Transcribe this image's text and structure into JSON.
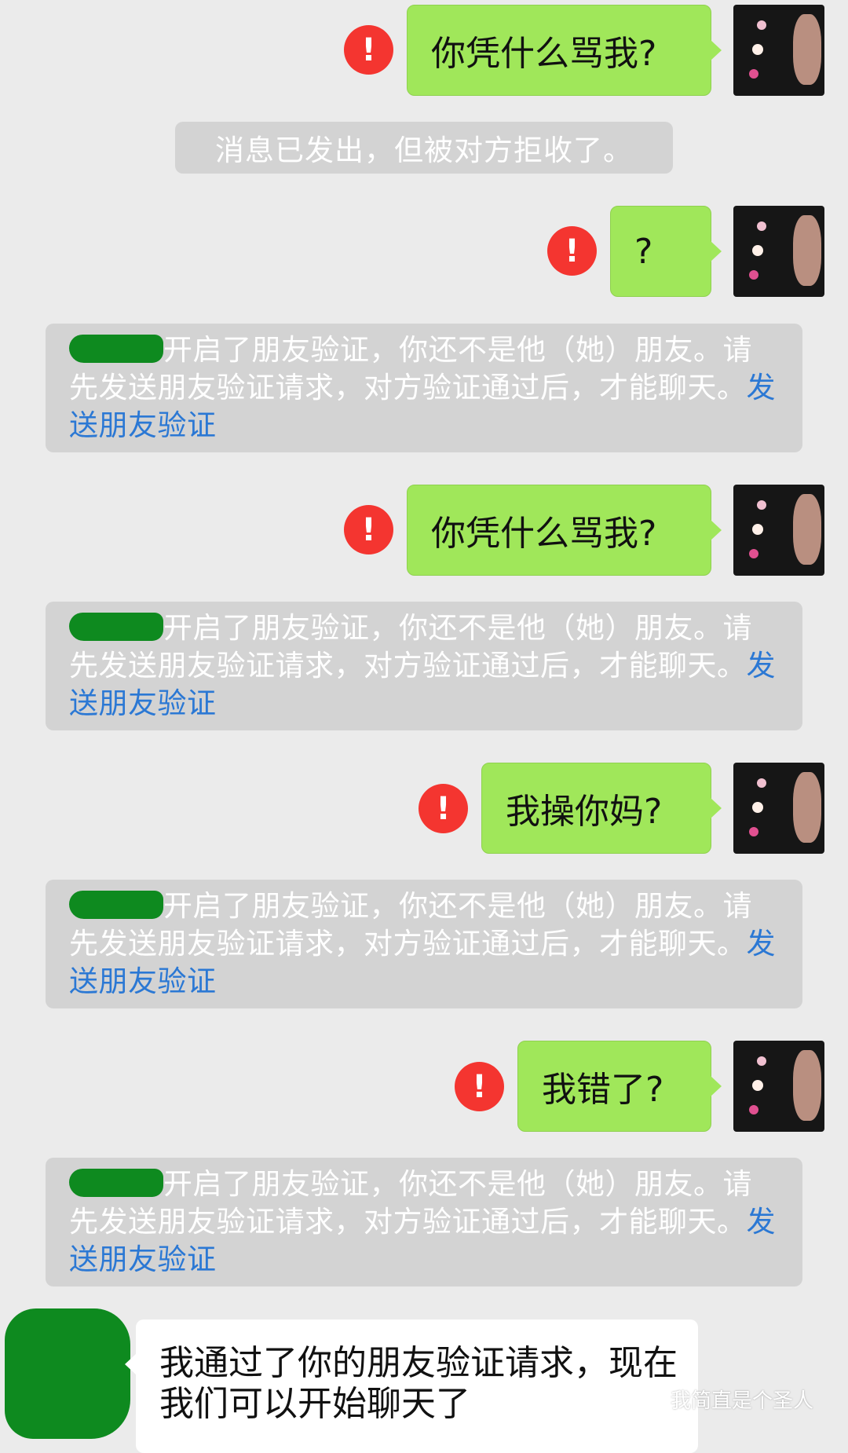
{
  "messages": [
    {
      "type": "out",
      "text": "你凭什么骂我?",
      "status": "failed"
    },
    {
      "type": "notice",
      "text": "消息已发出，但被对方拒收了。"
    },
    {
      "type": "out",
      "text": "?",
      "status": "failed"
    },
    {
      "type": "system",
      "text": "开启了朋友验证，你还不是他（她）朋友。请先发送朋友验证请求，对方验证通过后，才能聊天。",
      "link": "发送朋友验证"
    },
    {
      "type": "out",
      "text": "你凭什么骂我?",
      "status": "failed"
    },
    {
      "type": "system",
      "text": "开启了朋友验证，你还不是他（她）朋友。请先发送朋友验证请求，对方验证通过后，才能聊天。",
      "link": "发送朋友验证"
    },
    {
      "type": "out",
      "text": "我操你妈?",
      "status": "failed"
    },
    {
      "type": "system",
      "text": "开启了朋友验证，你还不是他（她）朋友。请先发送朋友验证请求，对方验证通过后，才能聊天。",
      "link": "发送朋友验证"
    },
    {
      "type": "out",
      "text": "我错了?",
      "status": "failed"
    },
    {
      "type": "system",
      "text": "开启了朋友验证，你还不是他（她）朋友。请先发送朋友验证请求，对方验证通过后，才能聊天。",
      "link": "发送朋友验证"
    },
    {
      "type": "in",
      "text": "我通过了你的朋友验证请求，现在我们可以开始聊天了"
    }
  ],
  "fail_mark": "!",
  "watermark": {
    "icon": "wechat-icon",
    "text": "我简直是个圣人"
  },
  "colors": {
    "background": "#ebebeb",
    "bubble_out": "#a0e75a",
    "fail": "#f43530",
    "notice_bg": "#d3d3d3",
    "link": "#2b78d4",
    "redaction": "#0e8a1f"
  }
}
